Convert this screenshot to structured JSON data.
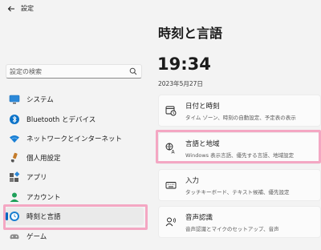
{
  "window": {
    "title": "設定"
  },
  "search": {
    "placeholder": "設定の検索"
  },
  "sidebar": {
    "items": [
      {
        "label": "システム",
        "icon": "monitor-icon"
      },
      {
        "label": "Bluetooth とデバイス",
        "icon": "bluetooth-icon"
      },
      {
        "label": "ネットワークとインターネット",
        "icon": "wifi-icon"
      },
      {
        "label": "個人用設定",
        "icon": "brush-icon"
      },
      {
        "label": "アプリ",
        "icon": "apps-icon"
      },
      {
        "label": "アカウント",
        "icon": "person-icon"
      },
      {
        "label": "時刻と言語",
        "icon": "globe-clock-icon",
        "selected": true
      },
      {
        "label": "ゲーム",
        "icon": "gamepad-icon"
      }
    ]
  },
  "main": {
    "title": "時刻と言語",
    "time": "19:34",
    "date": "2023年5月27日",
    "cards": [
      {
        "title": "日付と時刻",
        "subtitle": "タイム ゾーン、時刻の自動設定、予定表の表示",
        "icon": "calendar-clock-icon"
      },
      {
        "title": "言語と地域",
        "subtitle": "Windows 表示言語、優先する言語、地域設定",
        "icon": "language-icon",
        "highlighted": true
      },
      {
        "title": "入力",
        "subtitle": "タッチキーボード、テキスト候補、優先設定",
        "icon": "keyboard-icon"
      },
      {
        "title": "音声認識",
        "subtitle": "音声認識とマイクのセットアップ、音声",
        "icon": "speech-icon"
      }
    ]
  },
  "colors": {
    "accent": "#0067c0",
    "highlight": "#f4a7c3",
    "background": "#f3f3f3"
  }
}
